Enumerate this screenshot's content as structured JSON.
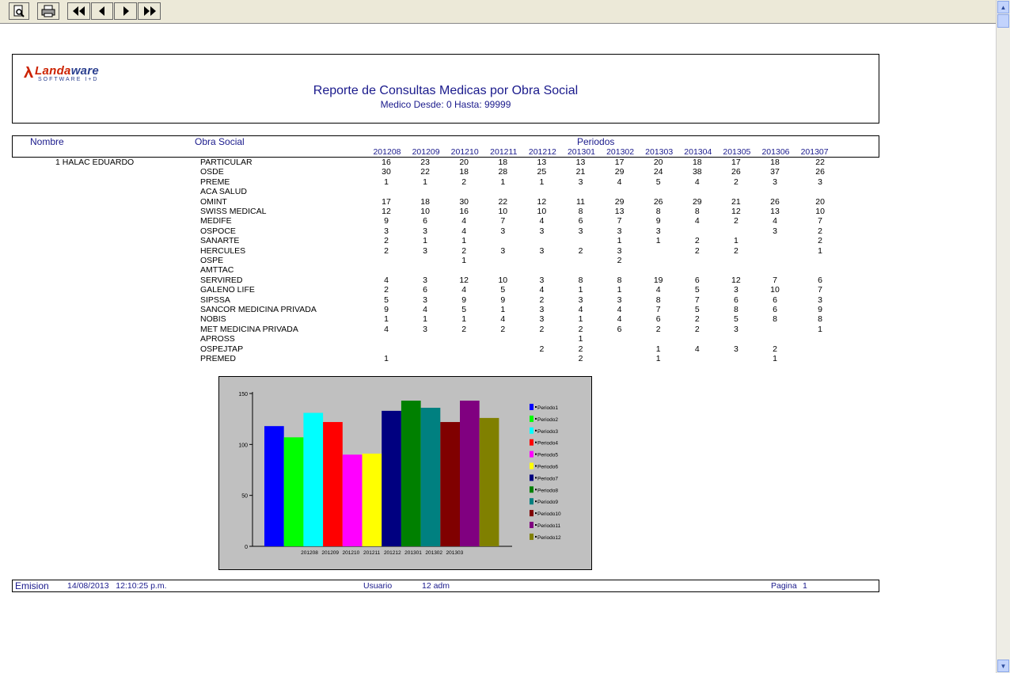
{
  "report": {
    "logo": {
      "name_part1": "Landa",
      "name_part2": "ware",
      "subtitle": "SOFTWARE I+D"
    },
    "title": "Reporte de Consultas Medicas por Obra Social",
    "subtitle": "Medico Desde: 0 Hasta: 99999",
    "columns": {
      "nombre": "Nombre",
      "obra_social": "Obra Social",
      "periodos": "Periodos"
    },
    "periods": [
      "201208",
      "201209",
      "201210",
      "201211",
      "201212",
      "201301",
      "201302",
      "201303",
      "201304",
      "201305",
      "201306",
      "201307"
    ],
    "doctor": "1 HALAC EDUARDO",
    "rows": [
      {
        "name": "PARTICULAR",
        "values": [
          "16",
          "23",
          "20",
          "18",
          "13",
          "13",
          "17",
          "20",
          "18",
          "17",
          "18",
          "22"
        ]
      },
      {
        "name": "OSDE",
        "values": [
          "30",
          "22",
          "18",
          "28",
          "25",
          "21",
          "29",
          "24",
          "38",
          "26",
          "37",
          "26"
        ]
      },
      {
        "name": "PREME",
        "values": [
          "1",
          "1",
          "2",
          "1",
          "1",
          "3",
          "4",
          "5",
          "4",
          "2",
          "3",
          "3"
        ]
      },
      {
        "name": "ACA SALUD",
        "values": [
          "",
          "",
          "",
          "",
          "",
          "",
          "",
          "",
          "",
          "",
          "",
          ""
        ]
      },
      {
        "name": "OMINT",
        "values": [
          "17",
          "18",
          "30",
          "22",
          "12",
          "11",
          "29",
          "26",
          "29",
          "21",
          "26",
          "20"
        ]
      },
      {
        "name": "SWISS MEDICAL",
        "values": [
          "12",
          "10",
          "16",
          "10",
          "10",
          "8",
          "13",
          "8",
          "8",
          "12",
          "13",
          "10"
        ]
      },
      {
        "name": "MEDIFE",
        "values": [
          "9",
          "6",
          "4",
          "7",
          "4",
          "6",
          "7",
          "9",
          "4",
          "2",
          "4",
          "7"
        ]
      },
      {
        "name": "OSPOCE",
        "values": [
          "3",
          "3",
          "4",
          "3",
          "3",
          "3",
          "3",
          "3",
          "",
          "",
          "3",
          "2"
        ]
      },
      {
        "name": "SANARTE",
        "values": [
          "2",
          "1",
          "1",
          "",
          "",
          "",
          "1",
          "1",
          "2",
          "1",
          "",
          "2"
        ]
      },
      {
        "name": "HERCULES",
        "values": [
          "2",
          "3",
          "2",
          "3",
          "3",
          "2",
          "3",
          "",
          "2",
          "2",
          "",
          "1"
        ]
      },
      {
        "name": "OSPE",
        "values": [
          "",
          "",
          "1",
          "",
          "",
          "",
          "2",
          "",
          "",
          "",
          "",
          ""
        ]
      },
      {
        "name": "AMTTAC",
        "values": [
          "",
          "",
          "",
          "",
          "",
          "",
          "",
          "",
          "",
          "",
          "",
          ""
        ]
      },
      {
        "name": "SERVIRED",
        "values": [
          "4",
          "3",
          "12",
          "10",
          "3",
          "8",
          "8",
          "19",
          "6",
          "12",
          "7",
          "6"
        ]
      },
      {
        "name": "GALENO LIFE",
        "values": [
          "2",
          "6",
          "4",
          "5",
          "4",
          "1",
          "1",
          "4",
          "5",
          "3",
          "10",
          "7"
        ]
      },
      {
        "name": "SIPSSA",
        "values": [
          "5",
          "3",
          "9",
          "9",
          "2",
          "3",
          "3",
          "8",
          "7",
          "6",
          "6",
          "3"
        ]
      },
      {
        "name": "SANCOR MEDICINA PRIVADA",
        "values": [
          "9",
          "4",
          "5",
          "1",
          "3",
          "4",
          "4",
          "7",
          "5",
          "8",
          "6",
          "9"
        ]
      },
      {
        "name": "NOBIS",
        "values": [
          "1",
          "1",
          "1",
          "4",
          "3",
          "1",
          "4",
          "6",
          "2",
          "5",
          "8",
          "8"
        ]
      },
      {
        "name": "MET MEDICINA PRIVADA",
        "values": [
          "4",
          "3",
          "2",
          "2",
          "2",
          "2",
          "6",
          "2",
          "2",
          "3",
          "",
          "1"
        ]
      },
      {
        "name": "APROSS",
        "values": [
          "",
          "",
          "",
          "",
          "",
          "1",
          "",
          "",
          "",
          "",
          "",
          ""
        ]
      },
      {
        "name": "OSPEJTAP",
        "values": [
          "",
          "",
          "",
          "",
          "2",
          "2",
          "",
          "1",
          "4",
          "3",
          "2",
          ""
        ]
      },
      {
        "name": "PREMED",
        "values": [
          "1",
          "",
          "",
          "",
          "",
          "2",
          "",
          "1",
          "",
          "",
          "1",
          ""
        ]
      }
    ]
  },
  "footer": {
    "emision_label": "Emision",
    "emision_value": "14/08/2013   12:10:25 p.m.",
    "usuario_label": "Usuario",
    "usuario_value": "12 adm",
    "pagina_label": "Pagina",
    "pagina_value": "1"
  },
  "toolbar": {
    "icons": [
      "preview-icon",
      "print-icon",
      "first-page-icon",
      "prev-page-icon",
      "next-page-icon",
      "last-page-icon"
    ]
  },
  "chart_data": {
    "type": "bar",
    "categories": [
      "201208",
      "201209",
      "201210",
      "201211",
      "201212",
      "201301",
      "201302",
      "201303"
    ],
    "series": [
      {
        "name": "Periodo1",
        "value": 118,
        "color": "#0000ff"
      },
      {
        "name": "Periodo2",
        "value": 107,
        "color": "#00ff00"
      },
      {
        "name": "Periodo3",
        "value": 131,
        "color": "#00ffff"
      },
      {
        "name": "Periodo4",
        "value": 122,
        "color": "#ff0000"
      },
      {
        "name": "Periodo5",
        "value": 90,
        "color": "#ff00ff"
      },
      {
        "name": "Periodo6",
        "value": 91,
        "color": "#ffff00"
      },
      {
        "name": "Periodo7",
        "value": 133,
        "color": "#000080"
      },
      {
        "name": "Periodo8",
        "value": 143,
        "color": "#008000"
      },
      {
        "name": "Periodo9",
        "value": 136,
        "color": "#008080"
      },
      {
        "name": "Periodo10",
        "value": 122,
        "color": "#800000"
      },
      {
        "name": "Periodo11",
        "value": 143,
        "color": "#800080"
      },
      {
        "name": "Periodo12",
        "value": 126,
        "color": "#808000"
      }
    ],
    "yticks": [
      "150",
      "100",
      "50",
      "0"
    ],
    "ylim": [
      0,
      150
    ],
    "legend": "right"
  }
}
